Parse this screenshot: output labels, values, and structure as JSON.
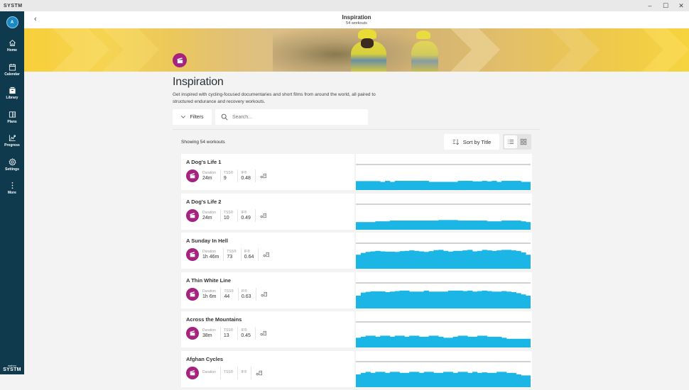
{
  "window": {
    "app_name": "SYSTM",
    "controls": {
      "minimize": "–",
      "maximize": "☐",
      "close": "✕"
    }
  },
  "sidebar": {
    "avatar_initial": "A",
    "items": [
      {
        "label": "Home",
        "icon": "home-icon",
        "active": false
      },
      {
        "label": "Calendar",
        "icon": "calendar-icon",
        "active": false
      },
      {
        "label": "Library",
        "icon": "library-icon",
        "active": true
      },
      {
        "label": "Plans",
        "icon": "plans-icon",
        "active": false
      },
      {
        "label": "Progress",
        "icon": "progress-icon",
        "active": false
      },
      {
        "label": "Settings",
        "icon": "gear-icon",
        "active": false
      },
      {
        "label": "More",
        "icon": "more-icon",
        "active": false
      }
    ],
    "brand_small": "wahoo",
    "brand_big": "SYSTM"
  },
  "header": {
    "back": "‹",
    "title": "Inspiration",
    "subtitle": "54 workouts"
  },
  "main": {
    "title": "Inspiration",
    "description": "Get inspired with cycling-focused documentaries and short films from around the world, all paired to structured endurance and recovery workouts.",
    "filters_label": "Filters",
    "search_placeholder": "Search...",
    "showing": "Showing 54 workouts",
    "sort_label": "Sort by Title",
    "view": "list"
  },
  "colors": {
    "sidebar": "#0f3a4e",
    "category": "#a5237f",
    "profile": "#1cb6e6"
  },
  "workouts": [
    {
      "name": "A Dog's Life 1",
      "duration_label": "Duration",
      "duration": "24m",
      "tss_label": "TSS®",
      "tss": "9",
      "if_label": "IF®",
      "if": "0.48",
      "profile": [
        0.35,
        0.35,
        0.35,
        0.35,
        0.35,
        0.32,
        0.36,
        0.32,
        0.36,
        0.36,
        0.36,
        0.36,
        0.36,
        0.36,
        0.36,
        0.32,
        0.32,
        0.32,
        0.32,
        0.32,
        0.32,
        0.36,
        0.36,
        0.36,
        0.34,
        0.34,
        0.36,
        0.34,
        0.36,
        0.32,
        0.36,
        0.36,
        0.36,
        0.36,
        0.32,
        0.32
      ]
    },
    {
      "name": "A Dog's Life 2",
      "duration_label": "Duration",
      "duration": "24m",
      "tss_label": "TSS®",
      "tss": "10",
      "if_label": "IF®",
      "if": "0.49",
      "profile": [
        0.3,
        0.3,
        0.3,
        0.3,
        0.33,
        0.33,
        0.33,
        0.36,
        0.36,
        0.36,
        0.36,
        0.36,
        0.36,
        0.36,
        0.36,
        0.36,
        0.36,
        0.38,
        0.38,
        0.38,
        0.38,
        0.36,
        0.36,
        0.36,
        0.36,
        0.36,
        0.36,
        0.33,
        0.33,
        0.33,
        0.36,
        0.36,
        0.36,
        0.36,
        0.33,
        0.3
      ]
    },
    {
      "name": "A Sunday In Hell",
      "duration_label": "Duration",
      "duration": "1h 46m",
      "tss_label": "TSS®",
      "tss": "73",
      "if_label": "IF®",
      "if": "0.64",
      "profile": [
        0.55,
        0.62,
        0.66,
        0.68,
        0.7,
        0.68,
        0.67,
        0.67,
        0.66,
        0.69,
        0.7,
        0.72,
        0.7,
        0.68,
        0.66,
        0.69,
        0.73,
        0.74,
        0.7,
        0.67,
        0.7,
        0.7,
        0.72,
        0.74,
        0.68,
        0.7,
        0.74,
        0.72,
        0.7,
        0.72,
        0.74,
        0.74,
        0.72,
        0.7,
        0.64,
        0.55
      ]
    },
    {
      "name": "A Thin White Line",
      "duration_label": "Duration",
      "duration": "1h 6m",
      "tss_label": "TSS®",
      "tss": "44",
      "if_label": "IF®",
      "if": "0.63",
      "profile": [
        0.5,
        0.62,
        0.65,
        0.67,
        0.67,
        0.67,
        0.64,
        0.66,
        0.68,
        0.7,
        0.7,
        0.66,
        0.66,
        0.66,
        0.7,
        0.66,
        0.66,
        0.66,
        0.66,
        0.7,
        0.7,
        0.7,
        0.68,
        0.7,
        0.66,
        0.68,
        0.7,
        0.68,
        0.66,
        0.66,
        0.68,
        0.66,
        0.64,
        0.6,
        0.55,
        0.5
      ]
    },
    {
      "name": "Across the Mountains",
      "duration_label": "Duration",
      "duration": "38m",
      "tss_label": "TSS®",
      "tss": "13",
      "if_label": "IF®",
      "if": "0.45",
      "profile": [
        0.38,
        0.42,
        0.46,
        0.46,
        0.42,
        0.46,
        0.46,
        0.42,
        0.46,
        0.46,
        0.42,
        0.46,
        0.46,
        0.42,
        0.42,
        0.46,
        0.46,
        0.42,
        0.38,
        0.38,
        0.42,
        0.46,
        0.46,
        0.42,
        0.42,
        0.46,
        0.46,
        0.42,
        0.42,
        0.42,
        0.38,
        0.34,
        0.34,
        0.34,
        0.34,
        0.34
      ]
    },
    {
      "name": "Afghan Cycles",
      "duration_label": "Duration",
      "duration": "",
      "tss_label": "TSS®",
      "tss": "",
      "if_label": "IF®",
      "if": "",
      "profile": [
        0.5,
        0.56,
        0.6,
        0.56,
        0.6,
        0.6,
        0.56,
        0.6,
        0.6,
        0.56,
        0.56,
        0.6,
        0.6,
        0.56,
        0.6,
        0.6,
        0.56,
        0.56,
        0.6,
        0.6,
        0.56,
        0.6,
        0.6,
        0.56,
        0.6,
        0.56,
        0.58,
        0.56,
        0.56,
        0.6,
        0.6,
        0.56,
        0.56,
        0.5,
        0.46,
        0.46
      ]
    }
  ]
}
